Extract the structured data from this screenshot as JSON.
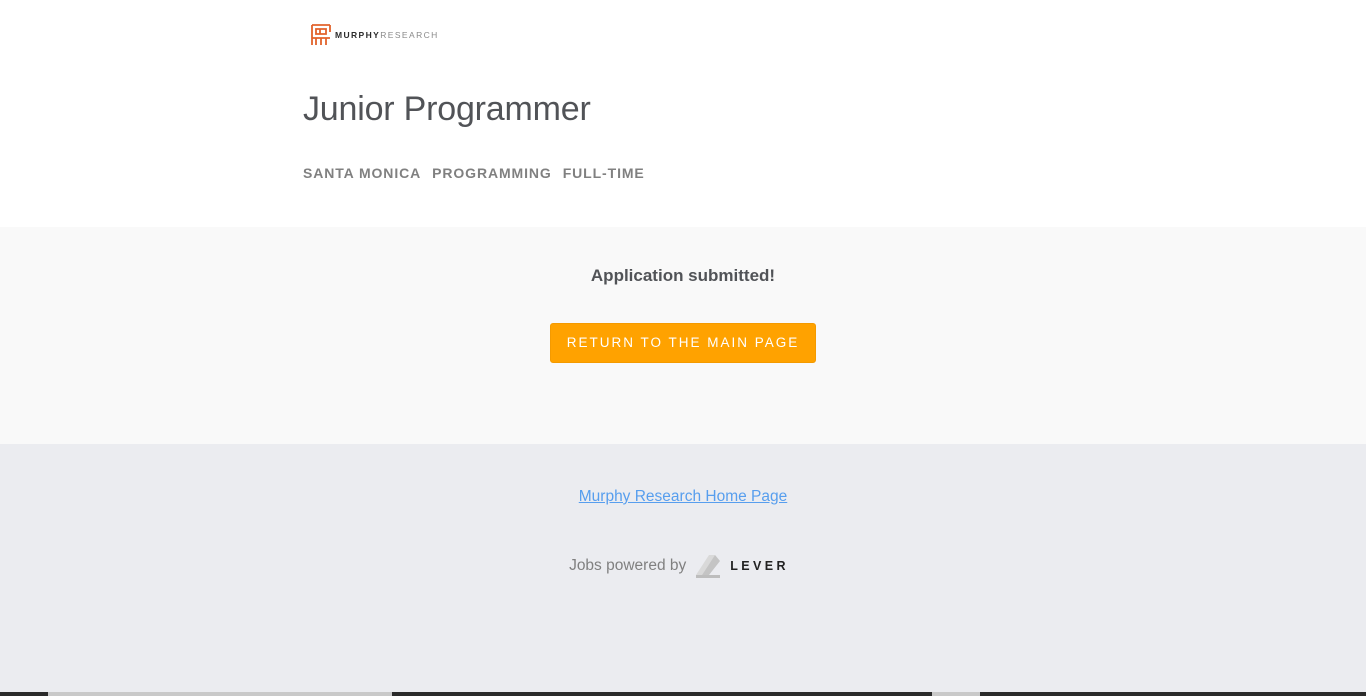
{
  "brand": {
    "logo_strong": "MURPHY",
    "logo_light": "RESEARCH",
    "logo_color": "#e2622b"
  },
  "job": {
    "title": "Junior Programmer",
    "categories": [
      "SANTA MONICA",
      "PROGRAMMING",
      "FULL-TIME"
    ]
  },
  "confirmation": {
    "message": "Application submitted!",
    "return_label": "RETURN TO THE MAIN PAGE",
    "button_color": "#ffa200"
  },
  "footer": {
    "home_link": "Murphy Research Home Page",
    "powered_by": "Jobs powered by",
    "lever_label": "LEVER",
    "link_color": "#579eee"
  }
}
